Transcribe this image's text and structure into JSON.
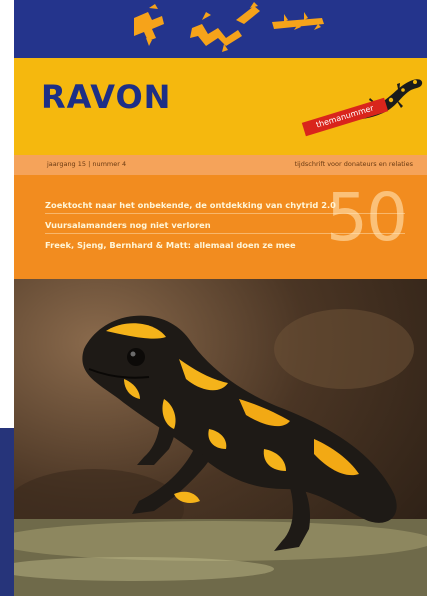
{
  "magazine": {
    "title": "RAVON",
    "theme_badge": "themanummer",
    "volume_issue": "jaargang 15 | nummer 4",
    "tagline": "tijdschrift voor donateurs en relaties",
    "issue_number": "50"
  },
  "headlines": [
    "Zoektocht naar het onbekende, de ontdekking van chytrid 2.0",
    "Vuursalamanders nog niet verloren",
    "Freek, Sjeng, Bernhard & Matt: allemaal doen ze mee"
  ],
  "colors": {
    "navy": "#24348c",
    "yellow": "#f5b80e",
    "orange": "#f28c1f",
    "red": "#d9251c"
  },
  "cover_photo": {
    "subject": "fire-salamander"
  }
}
